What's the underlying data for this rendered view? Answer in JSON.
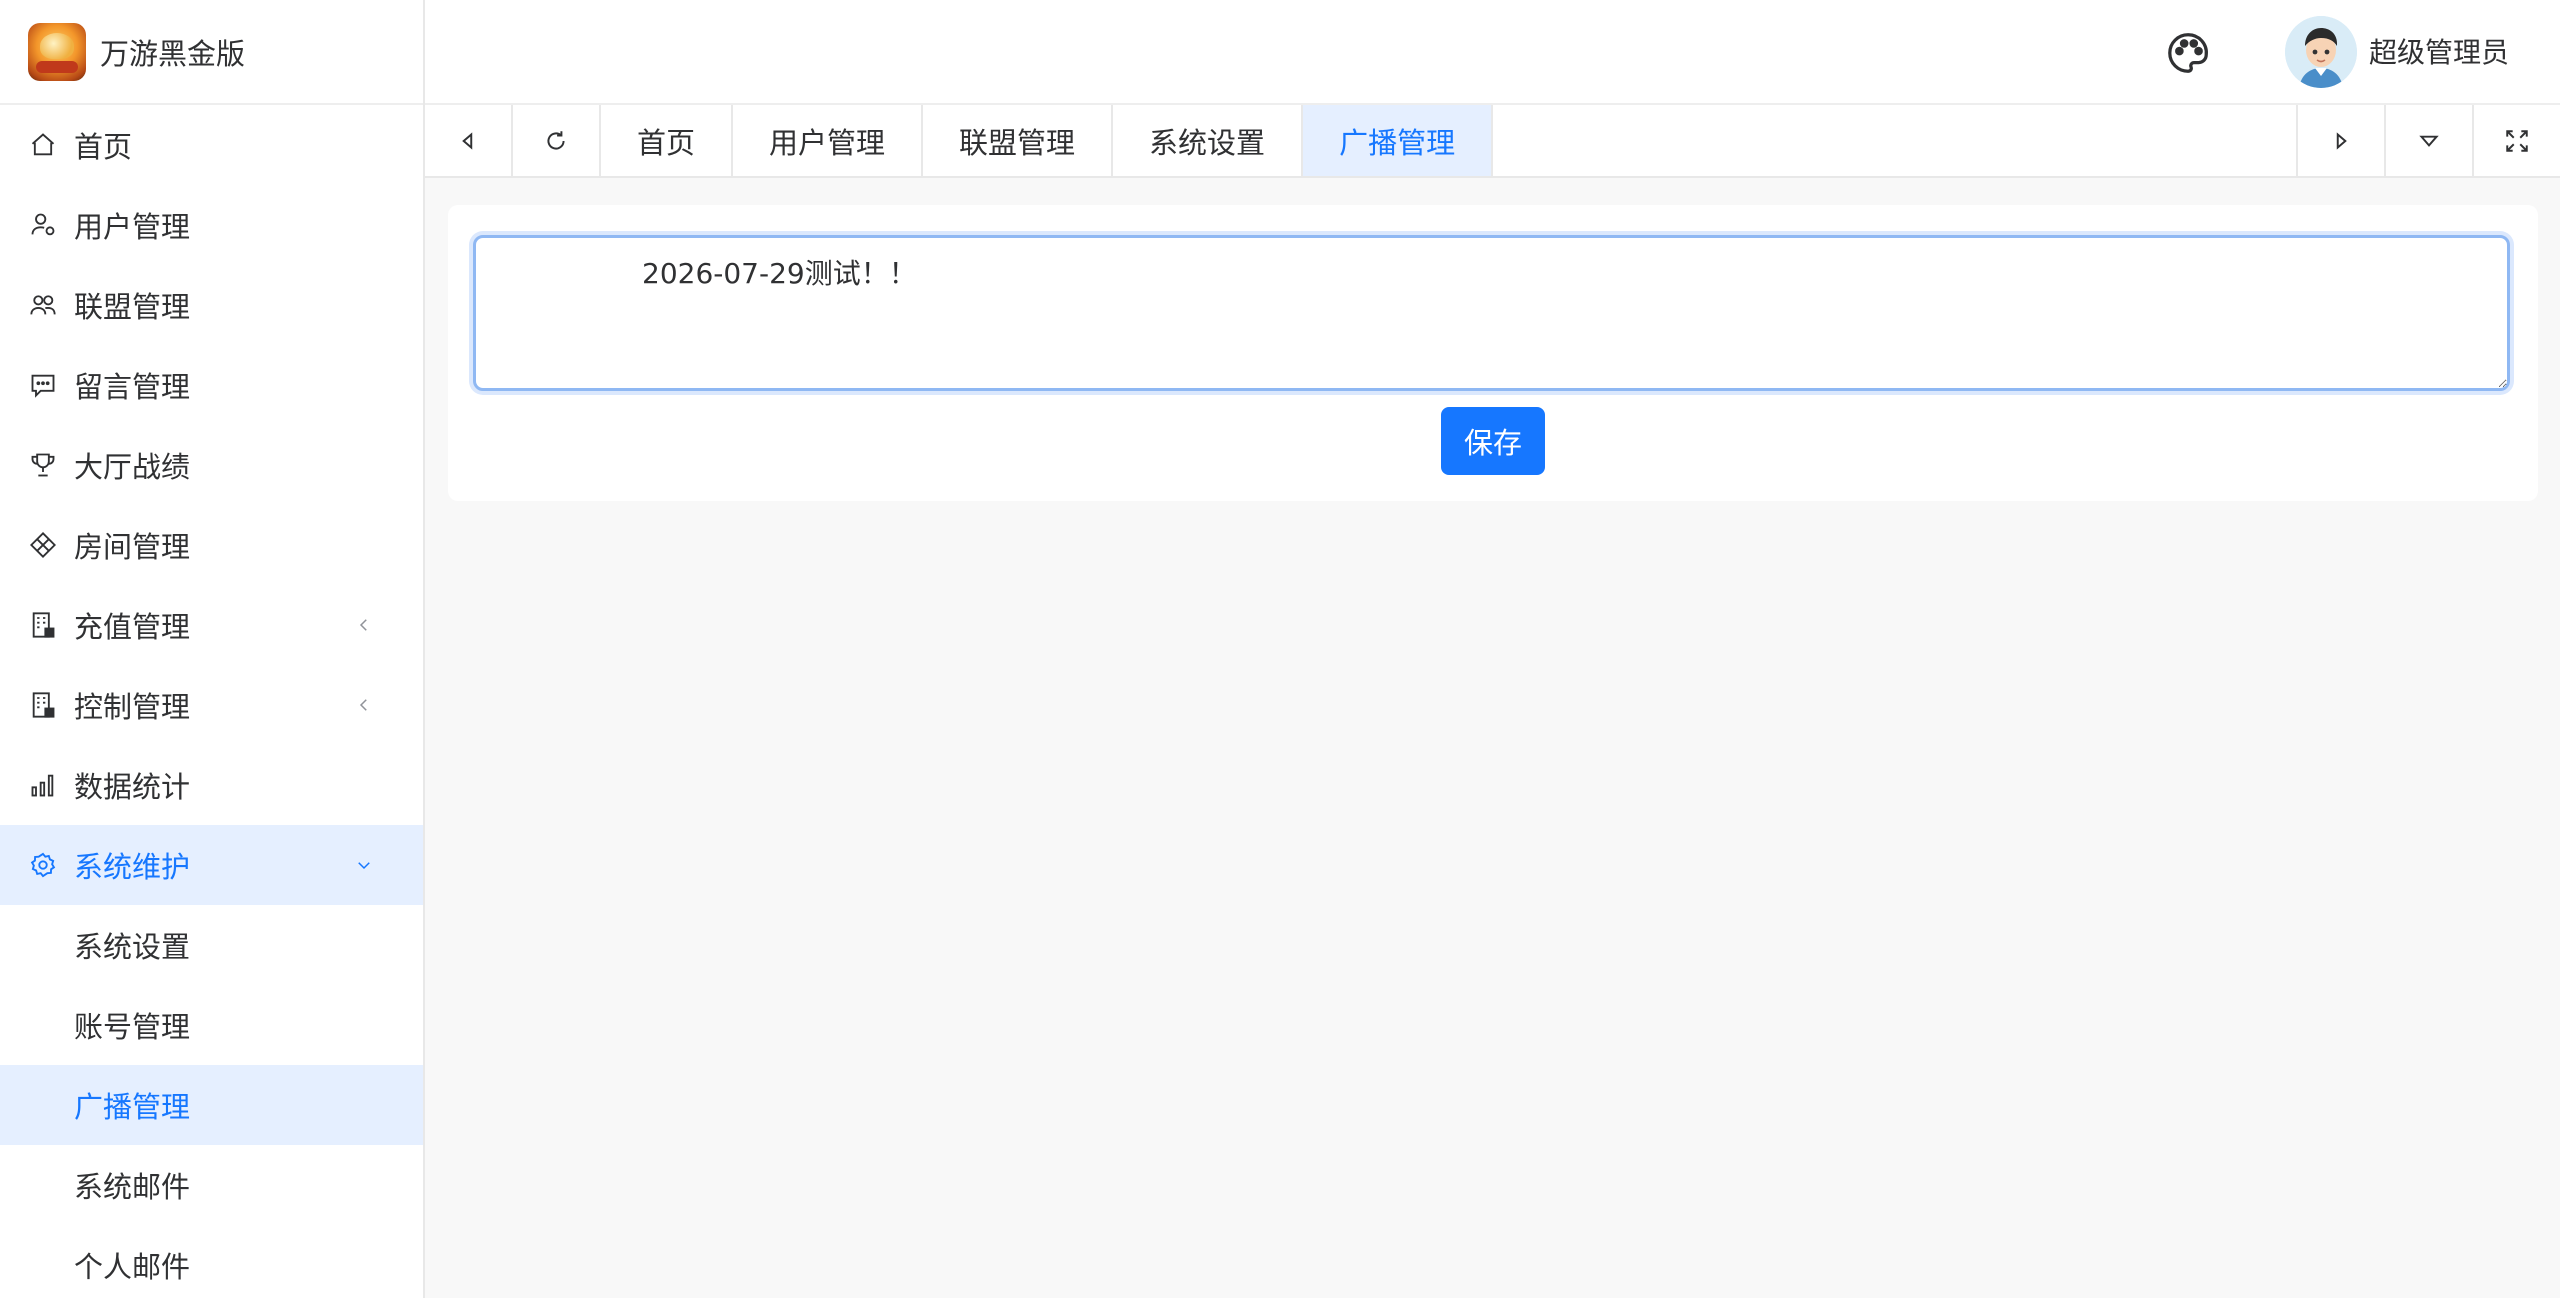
{
  "app": {
    "title": "万游黑金版"
  },
  "sidebar": {
    "items": [
      {
        "label": "首页",
        "icon": "home-icon"
      },
      {
        "label": "用户管理",
        "icon": "user-gear-icon"
      },
      {
        "label": "联盟管理",
        "icon": "group-icon"
      },
      {
        "label": "留言管理",
        "icon": "message-icon"
      },
      {
        "label": "大厅战绩",
        "icon": "trophy-icon"
      },
      {
        "label": "房间管理",
        "icon": "room-icon"
      },
      {
        "label": "充值管理",
        "icon": "building-icon",
        "collapsible": true
      },
      {
        "label": "控制管理",
        "icon": "building-icon",
        "collapsible": true
      },
      {
        "label": "数据统计",
        "icon": "bar-chart-icon"
      },
      {
        "label": "系统维护",
        "icon": "settings-icon",
        "collapsible": true,
        "expanded": true
      }
    ],
    "sub_items": [
      {
        "label": "系统设置"
      },
      {
        "label": "账号管理"
      },
      {
        "label": "广播管理",
        "active": true
      },
      {
        "label": "系统邮件"
      },
      {
        "label": "个人邮件"
      }
    ]
  },
  "header": {
    "theme_icon": "palette-icon",
    "username": "超级管理员"
  },
  "tabs": {
    "items": [
      {
        "label": "首页"
      },
      {
        "label": "用户管理"
      },
      {
        "label": "联盟管理"
      },
      {
        "label": "系统设置"
      },
      {
        "label": "广播管理",
        "active": true
      }
    ]
  },
  "broadcast": {
    "message": "2026-07-29测试！！",
    "save_label": "保存"
  },
  "colors": {
    "accent": "#1677ff",
    "active_bg": "#e5efff",
    "page_bg": "#f8f8f8"
  }
}
